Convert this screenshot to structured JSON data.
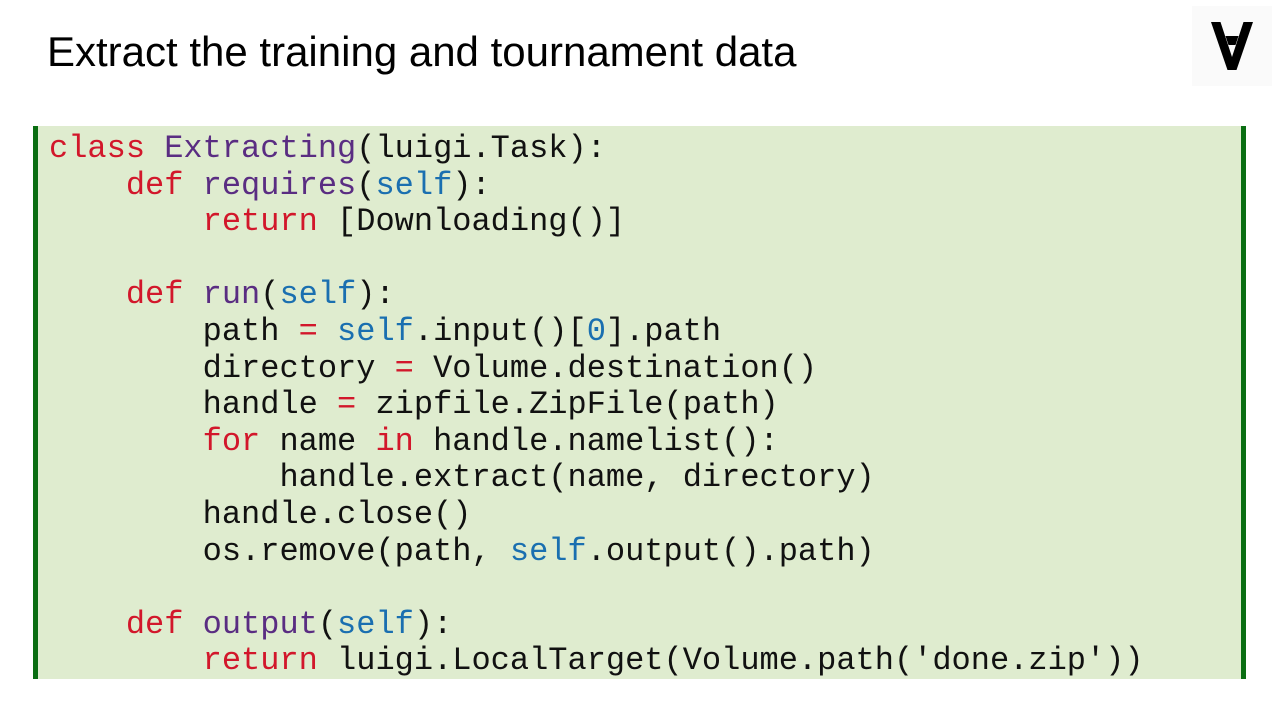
{
  "slide": {
    "title": "Extract the training and tournament data"
  },
  "logo": {
    "icon": "for-all-symbol-logo",
    "glyph": "∀"
  },
  "colors": {
    "code_background": "#dfeccf",
    "code_border": "#0a6e12",
    "keyword": "#d2172b",
    "function_name": "#5a2d82",
    "self": "#1a6fb0",
    "plain": "#111111"
  },
  "code": {
    "language": "python",
    "lines": [
      [
        {
          "t": "kw",
          "v": "class"
        },
        {
          "t": "txt",
          "v": " "
        },
        {
          "t": "fn",
          "v": "Extracting"
        },
        {
          "t": "txt",
          "v": "(luigi.Task):"
        }
      ],
      [
        {
          "t": "txt",
          "v": "    "
        },
        {
          "t": "kw",
          "v": "def"
        },
        {
          "t": "txt",
          "v": " "
        },
        {
          "t": "fn",
          "v": "requires"
        },
        {
          "t": "txt",
          "v": "("
        },
        {
          "t": "self",
          "v": "self"
        },
        {
          "t": "txt",
          "v": "):"
        }
      ],
      [
        {
          "t": "txt",
          "v": "        "
        },
        {
          "t": "kw",
          "v": "return"
        },
        {
          "t": "txt",
          "v": " [Downloading()]"
        }
      ],
      [],
      [
        {
          "t": "txt",
          "v": "    "
        },
        {
          "t": "kw",
          "v": "def"
        },
        {
          "t": "txt",
          "v": " "
        },
        {
          "t": "fn",
          "v": "run"
        },
        {
          "t": "txt",
          "v": "("
        },
        {
          "t": "self",
          "v": "self"
        },
        {
          "t": "txt",
          "v": "):"
        }
      ],
      [
        {
          "t": "txt",
          "v": "        path "
        },
        {
          "t": "kw",
          "v": "="
        },
        {
          "t": "txt",
          "v": " "
        },
        {
          "t": "self",
          "v": "self"
        },
        {
          "t": "txt",
          "v": ".input()["
        },
        {
          "t": "num",
          "v": "0"
        },
        {
          "t": "txt",
          "v": "].path"
        }
      ],
      [
        {
          "t": "txt",
          "v": "        directory "
        },
        {
          "t": "kw",
          "v": "="
        },
        {
          "t": "txt",
          "v": " Volume.destination()"
        }
      ],
      [
        {
          "t": "txt",
          "v": "        handle "
        },
        {
          "t": "kw",
          "v": "="
        },
        {
          "t": "txt",
          "v": " zipfile.ZipFile(path)"
        }
      ],
      [
        {
          "t": "txt",
          "v": "        "
        },
        {
          "t": "kw",
          "v": "for"
        },
        {
          "t": "txt",
          "v": " name "
        },
        {
          "t": "kw",
          "v": "in"
        },
        {
          "t": "txt",
          "v": " handle.namelist():"
        }
      ],
      [
        {
          "t": "txt",
          "v": "            handle.extract(name, directory)"
        }
      ],
      [
        {
          "t": "txt",
          "v": "        handle.close()"
        }
      ],
      [
        {
          "t": "txt",
          "v": "        os.remove(path, "
        },
        {
          "t": "self",
          "v": "self"
        },
        {
          "t": "txt",
          "v": ".output().path)"
        }
      ],
      [],
      [
        {
          "t": "txt",
          "v": "    "
        },
        {
          "t": "kw",
          "v": "def"
        },
        {
          "t": "txt",
          "v": " "
        },
        {
          "t": "fn",
          "v": "output"
        },
        {
          "t": "txt",
          "v": "("
        },
        {
          "t": "self",
          "v": "self"
        },
        {
          "t": "txt",
          "v": "):"
        }
      ],
      [
        {
          "t": "txt",
          "v": "        "
        },
        {
          "t": "kw",
          "v": "return"
        },
        {
          "t": "txt",
          "v": " luigi.LocalTarget(Volume.path('done.zip'))"
        }
      ]
    ]
  }
}
